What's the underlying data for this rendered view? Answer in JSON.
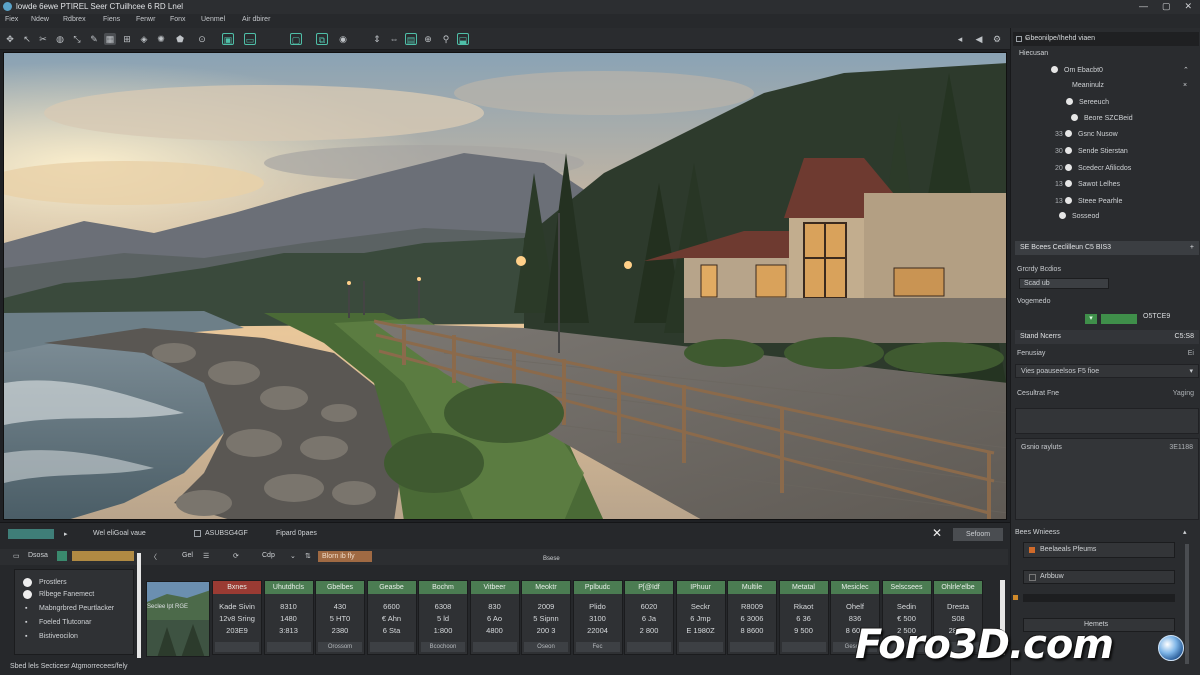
{
  "window": {
    "title": "lowde 6ewe PTIREL Seer CTuilhcee 6 RD Lnel"
  },
  "menu": [
    "Fiex",
    "Ndew",
    "Rdbrex",
    "Fiens",
    "Fenwr",
    "Fonx",
    "Uenmel",
    "Air dbirer"
  ],
  "right_panel": {
    "header": "Gbeonilpe/Ihehd viaen",
    "section": "Hiecusan",
    "tree": [
      {
        "num": "",
        "label": "Om Ebacbt0",
        "dot": true
      },
      {
        "num": "",
        "label": "Meaninulz",
        "dot": false
      },
      {
        "num": "",
        "label": "Sereeuch",
        "dot": true
      },
      {
        "num": "",
        "label": "Beore SZCBeid",
        "dot": true
      },
      {
        "num": "33",
        "label": "Gsnc Nusow",
        "dot": true
      },
      {
        "num": "30",
        "label": "Sende Stierstan",
        "dot": true
      },
      {
        "num": "20",
        "label": "Scedecr Afilicdos",
        "dot": true
      },
      {
        "num": "13",
        "label": "Sawot Lelhes",
        "dot": true
      },
      {
        "num": "13",
        "label": "Steee Pearhle",
        "dot": true
      },
      {
        "num": "",
        "label": "Sosseod",
        "dot": true
      }
    ],
    "bar1": "SE Bcees Ceclilleun C5 BIS3",
    "props_label": "Grcrdy Bcdios",
    "props_value": "Scad ub",
    "vis_label": "Vogemedo",
    "vis_value": "O5TCE9",
    "bar2_left": "Stand Ncerrs",
    "bar2_right": "C5:S8",
    "row1_label": "Fenusiay",
    "row1_value": "Ei",
    "row2_label": "Vies poauseelsos F5 fioe",
    "row3_label": "Cesultrat Fne",
    "row3_value": "Yaging",
    "row4_label": "Gsnio rayluts",
    "row4_value": "3E1188"
  },
  "bottom_right": {
    "title": "Bees Wnieess",
    "item1": "Beelaeals Pfeums",
    "item2": "Arbbuw",
    "item3": "Hemets"
  },
  "bottom": {
    "tab": "Wel eliGoal vaue",
    "field1": "ASUBSG4GF",
    "field2": "Fipard 0paes",
    "close_button": "Sefoom",
    "sub_tabs": [
      "Dsosa",
      "Gel",
      "Cdp",
      "Blorn ib fly"
    ],
    "sub_label": "Bsese",
    "tree": [
      "Prostlers",
      "Rlbege Fanemect",
      "Mabngrbred Peurtlacker",
      "Foeled Tlutconar",
      "Bistiveocilon"
    ],
    "status": "Sbed lels Secticesr Atgmorrecees/fely",
    "thumb_label": "Seclee lpt RGE",
    "columns": [
      {
        "hd": "Bxnes",
        "red": true,
        "rows": [
          "Kade Sivin",
          "12v8 Sring",
          "203E9"
        ],
        "ft": ""
      },
      {
        "hd": "Uhutdhcls",
        "rows": [
          "8310",
          "1480",
          "3:813"
        ],
        "ft": ""
      },
      {
        "hd": "Gbelbes",
        "rows": [
          "430",
          "5 HT0",
          "2380"
        ],
        "ft": "Orossom"
      },
      {
        "hd": "Geasbe",
        "rows": [
          "6600",
          "€ Ahn",
          "6 Sta"
        ],
        "ft": ""
      },
      {
        "hd": "Bochm",
        "rows": [
          "6308",
          "5 ld",
          "1:800"
        ],
        "ft": "Bcochoon"
      },
      {
        "hd": "Vitbeer",
        "rows": [
          "830",
          "6 Ao",
          "4800"
        ],
        "ft": ""
      },
      {
        "hd": "Meoktr",
        "rows": [
          "2009",
          "5 Sipnn",
          "200 3"
        ],
        "ft": "Oseon"
      },
      {
        "hd": "Pplbudc",
        "rows": [
          "Plido",
          "3100",
          "22004"
        ],
        "ft": "Fec"
      },
      {
        "hd": "P[@Idf",
        "rows": [
          "6020",
          "6 Ja",
          "2 800"
        ],
        "ft": ""
      },
      {
        "hd": "IPhuur",
        "rows": [
          "Seckr",
          "6 Jmp",
          "E 1980Z"
        ],
        "ft": ""
      },
      {
        "hd": "Multile",
        "rows": [
          "R8009",
          "6 3006",
          "8 8600"
        ],
        "ft": ""
      },
      {
        "hd": "Metatal",
        "rows": [
          "Rkaot",
          "6 36",
          "9 500"
        ],
        "ft": ""
      },
      {
        "hd": "Mesiclec",
        "rows": [
          "Ohelf",
          "836",
          "8 600"
        ],
        "ft": "Gesoay"
      },
      {
        "hd": "Selscsees",
        "rows": [
          "Sedin",
          "€ 500",
          "2 500"
        ],
        "ft": ""
      },
      {
        "hd": "Ohlrle'elbe",
        "rows": [
          "Dresta",
          "S08",
          "28 00"
        ],
        "ft": ""
      }
    ]
  },
  "watermark": "Foro3D.com",
  "colors": {
    "accent": "#4fbfa8",
    "header_green": "#4b7c52",
    "header_red": "#9a3b33",
    "panel": "#2a2c2f"
  }
}
